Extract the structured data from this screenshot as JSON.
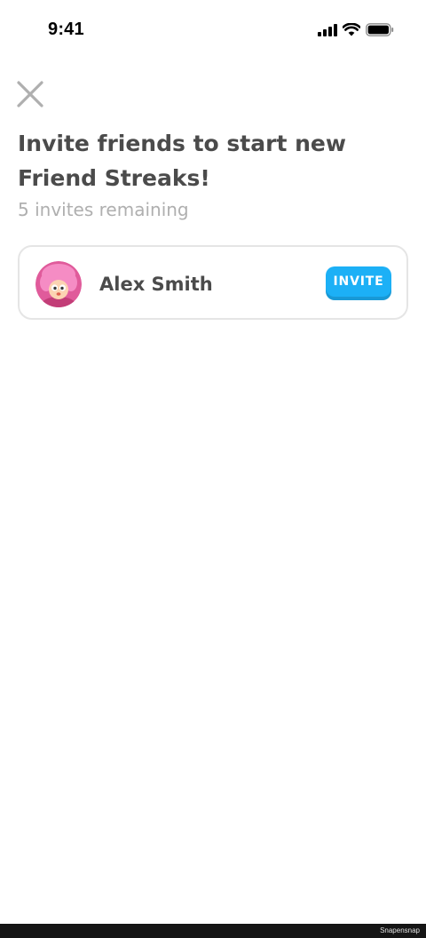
{
  "status_bar": {
    "time": "9:41",
    "icons": [
      "cellular-signal-icon",
      "wifi-icon",
      "battery-icon"
    ]
  },
  "header": {
    "close_icon": "close-icon",
    "title": "Invite friends to start new Friend Streaks!",
    "subtitle": "5 invites remaining"
  },
  "friends": [
    {
      "name": "Alex Smith",
      "avatar": "avatar-pink-character",
      "invite_label": "INVITE"
    }
  ],
  "footer": {
    "watermark": "Snapensnap"
  },
  "colors": {
    "primary_text": "#4b4b4b",
    "secondary_text": "#afafaf",
    "card_border": "#e5e5e5",
    "invite_button": "#1cb0f6",
    "invite_button_shadow": "#1899d6",
    "close_icon": "#afafaf",
    "avatar_bg": "#e05b9b"
  }
}
